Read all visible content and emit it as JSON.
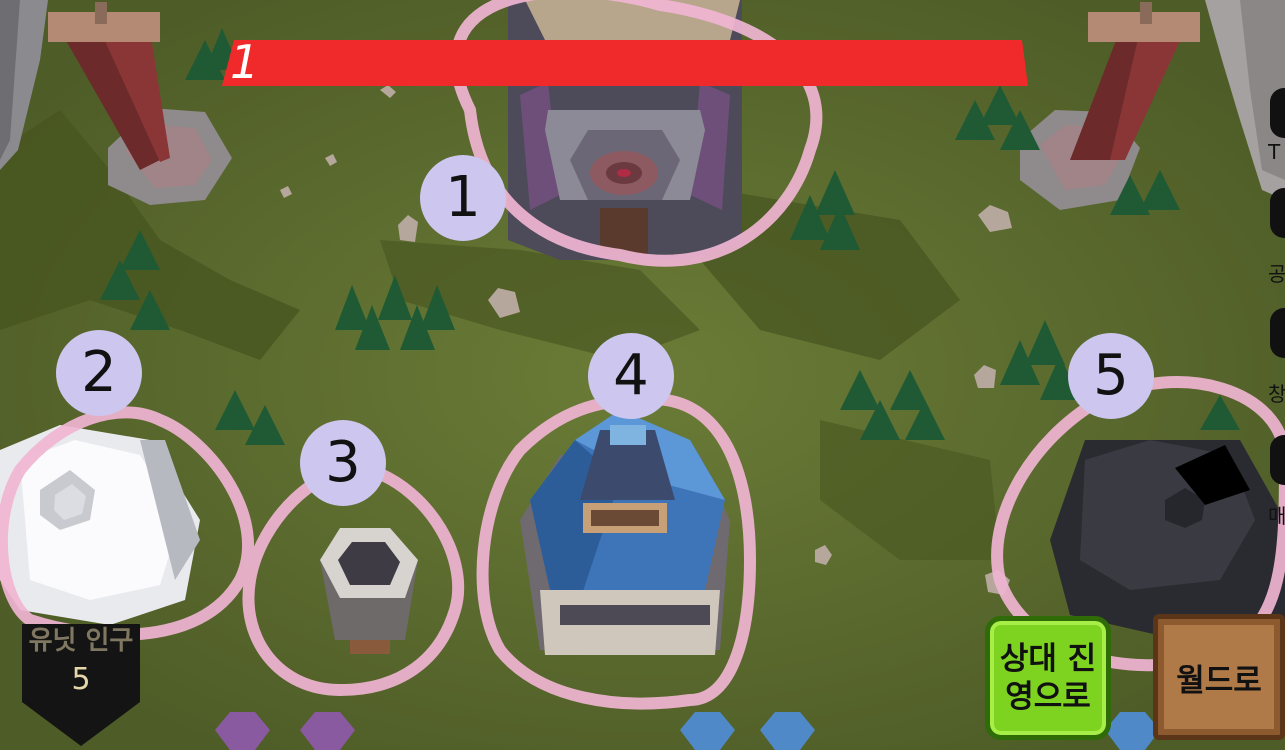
{
  "hp_bar": {
    "value": "1",
    "fill_color": "#f02a2a"
  },
  "markers": [
    "1",
    "2",
    "3",
    "4",
    "5"
  ],
  "unit_panel": {
    "label": "유닛 인구",
    "count": "5"
  },
  "buttons": {
    "to_enemy_base": "상대 진\n영으로",
    "to_world": "월드로"
  },
  "right_edge": {
    "t1": "T",
    "t2": "공",
    "t3": "창",
    "t4": "매"
  },
  "colors": {
    "grass": "#5b6b2e",
    "highlight_ring": "#f0b5d3",
    "marker_fill": "#cdc6ef",
    "green_button": "#7ed321",
    "wood_button": "#b07a48"
  }
}
